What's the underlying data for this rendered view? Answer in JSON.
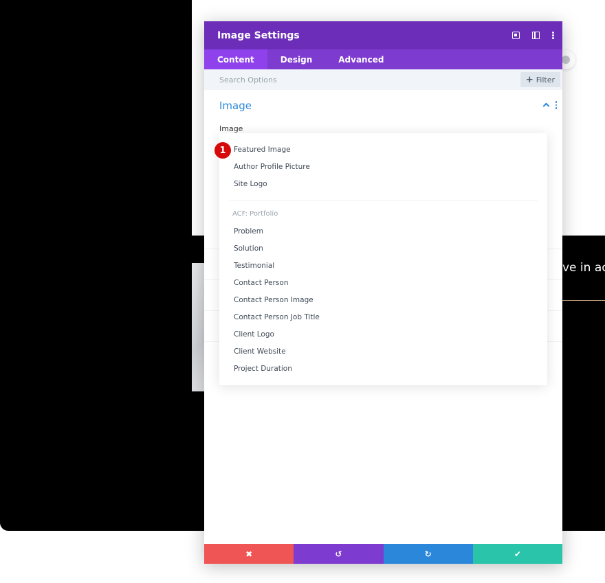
{
  "background": {
    "partial_text": "ve in ac"
  },
  "modal": {
    "title": "Image Settings",
    "tabs": [
      {
        "label": "Content"
      },
      {
        "label": "Design"
      },
      {
        "label": "Advanced"
      }
    ],
    "search": {
      "placeholder": "Search Options"
    },
    "filter_label": "Filter",
    "section": {
      "title": "Image"
    },
    "field_label": "Image",
    "badge": "1",
    "dropdown": {
      "items": [
        {
          "label": "Featured Image"
        },
        {
          "label": "Author Profile Picture"
        },
        {
          "label": "Site Logo"
        }
      ],
      "group_label": "ACF: Portfolio",
      "group_items": [
        {
          "label": "Problem"
        },
        {
          "label": "Solution"
        },
        {
          "label": "Testimonial"
        },
        {
          "label": "Contact Person"
        },
        {
          "label": "Contact Person Image"
        },
        {
          "label": "Contact Person Job Title"
        },
        {
          "label": "Client Logo"
        },
        {
          "label": "Client Website"
        },
        {
          "label": "Project Duration"
        }
      ]
    },
    "footer": {
      "close": "✖",
      "undo": "↺",
      "redo": "↻",
      "save": "✔"
    }
  },
  "colors": {
    "header": "#6c2eb9",
    "tabs": "#7e3bd0",
    "active_tab": "#8f42ec",
    "accent": "#2b87da",
    "close": "#ef5555",
    "save": "#29c4a9",
    "badge": "#d60a0a"
  }
}
